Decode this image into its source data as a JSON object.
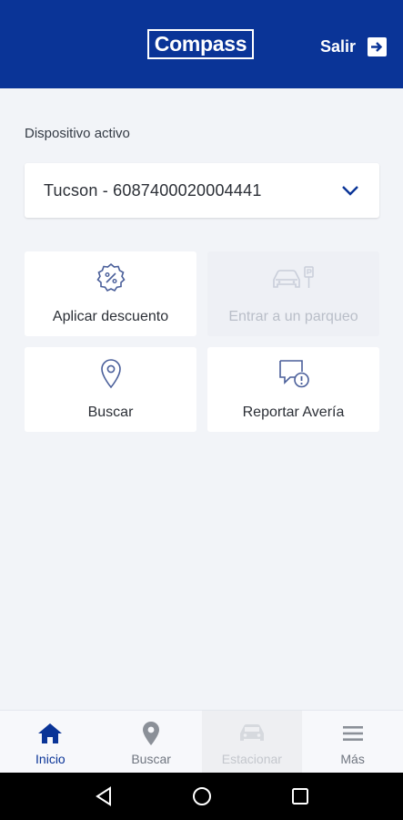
{
  "header": {
    "logo_text": "Compass",
    "logout_label": "Salir",
    "background_color": "#0a3497"
  },
  "device": {
    "section_label": "Dispositivo activo",
    "selected": "Tucson - 6087400020004441"
  },
  "actions": [
    {
      "label": "Aplicar descuento",
      "icon": "discount-icon",
      "enabled": true
    },
    {
      "label": "Entrar a un parqueo",
      "icon": "car-parking-icon",
      "enabled": false
    },
    {
      "label": "Buscar",
      "icon": "location-pin-icon",
      "enabled": true
    },
    {
      "label": "Reportar Avería",
      "icon": "report-issue-icon",
      "enabled": true
    }
  ],
  "bottom_nav": [
    {
      "label": "Inicio",
      "icon": "home-icon",
      "active": true
    },
    {
      "label": "Buscar",
      "icon": "location-pin-icon",
      "active": false
    },
    {
      "label": "Estacionar",
      "icon": "car-icon",
      "active": false,
      "enabled": false
    },
    {
      "label": "Más",
      "icon": "menu-icon",
      "active": false
    }
  ],
  "colors": {
    "primary": "#0a3497",
    "background": "#f2f4f8",
    "icon_blue": "#4a5f9a",
    "disabled": "#c9ceda"
  }
}
